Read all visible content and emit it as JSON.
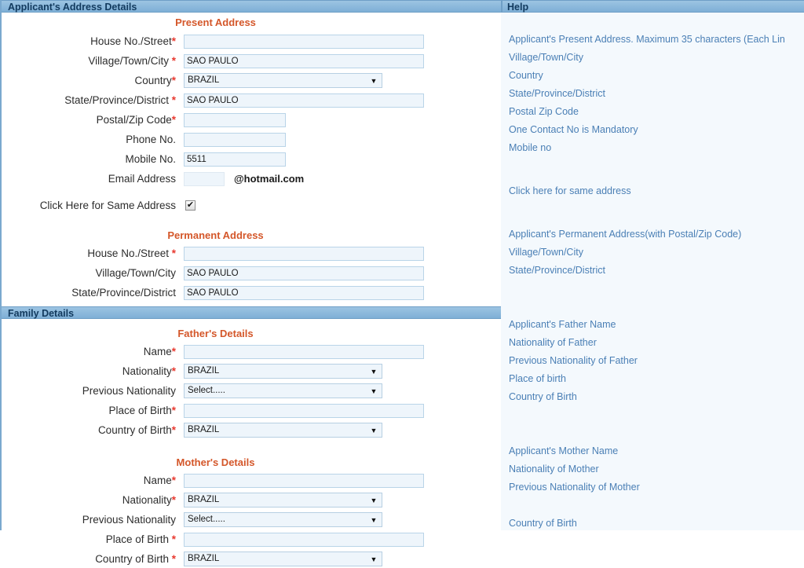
{
  "sections": {
    "address_header": "Applicant's Address Details",
    "family_header": "Family Details",
    "present_address_title": "Present Address",
    "permanent_address_title": "Permanent Address",
    "fathers_details_title": "Father's Details",
    "mothers_details_title": "Mother's Details"
  },
  "help": {
    "header": "Help",
    "present": {
      "house": "Applicant's Present Address. Maximum 35 characters (Each Lin",
      "village": "Village/Town/City",
      "country": "Country",
      "state": "State/Province/District",
      "postal": "Postal Zip Code",
      "phone": "One Contact No is Mandatory",
      "mobile": "Mobile no",
      "email": "",
      "same_address": "Click here for same address"
    },
    "permanent": {
      "house": "Applicant's Permanent Address(with Postal/Zip Code)",
      "village": "Village/Town/City",
      "state": "State/Province/District"
    },
    "father": {
      "name": "Applicant's Father Name",
      "nationality": "Nationality of Father",
      "previous_nationality": "Previous Nationality of Father",
      "place_of_birth": "Place of birth",
      "country_of_birth": "Country of Birth"
    },
    "mother": {
      "name": "Applicant's Mother Name",
      "nationality": "Nationality of Mother",
      "previous_nationality": "Previous Nationality of Mother",
      "place_of_birth": "",
      "country_of_birth": "Country of Birth"
    }
  },
  "present_address": {
    "house_label": "House No./Street",
    "house_required": "*",
    "house_value": "",
    "village_label": "Village/Town/City ",
    "village_required": "*",
    "village_value": "SAO PAULO",
    "country_label": "Country",
    "country_required": "*",
    "country_value": "BRAZIL",
    "state_label": "State/Province/District ",
    "state_required": "*",
    "state_value": "SAO PAULO",
    "postal_label": "Postal/Zip Code",
    "postal_required": "*",
    "postal_value": "",
    "phone_label": "Phone No.",
    "phone_value": "",
    "mobile_label": "Mobile No.",
    "mobile_value": "5511",
    "email_label": "Email Address",
    "email_value": "",
    "email_domain": "@hotmail.com",
    "same_address_label": "Click Here for Same Address",
    "same_address_checked": "✔"
  },
  "permanent_address": {
    "house_label": "House No./Street ",
    "house_required": "*",
    "house_value": "",
    "village_label": "Village/Town/City",
    "village_value": "SAO PAULO",
    "state_label": "State/Province/District",
    "state_value": "SAO PAULO"
  },
  "father": {
    "name_label": "Name",
    "name_required": "*",
    "name_value": "",
    "nationality_label": "Nationality",
    "nationality_required": "*",
    "nationality_value": "BRAZIL",
    "prev_nationality_label": "Previous Nationality",
    "prev_nationality_value": "Select.....",
    "place_label": "Place of Birth",
    "place_required": "*",
    "place_value": "",
    "country_label": "Country of Birth",
    "country_required": "*",
    "country_value": "BRAZIL"
  },
  "mother": {
    "name_label": "Name",
    "name_required": "*",
    "name_value": "",
    "nationality_label": "Nationality",
    "nationality_required": "*",
    "nationality_value": "BRAZIL",
    "prev_nationality_label": "Previous Nationality",
    "prev_nationality_value": "Select.....",
    "place_label": "Place of Birth ",
    "place_required": "*",
    "place_value": "",
    "country_label": "Country of Birth ",
    "country_required": "*",
    "country_value": "BRAZIL"
  },
  "icons": {
    "dropdown_arrow": "▼"
  },
  "colors": {
    "section_bar": "#8ab8dc",
    "sub_title": "#d4572a",
    "required_asterisk": "#e8392f",
    "help_text": "#4a7fb5",
    "input_bg": "#eef5fb"
  }
}
